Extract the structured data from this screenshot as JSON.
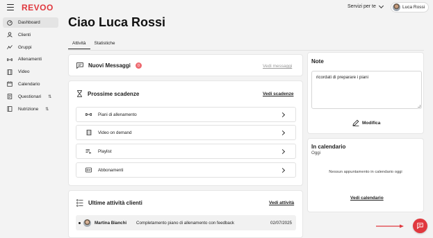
{
  "app": {
    "logo": "REVOO",
    "services_label": "Servizi per te",
    "user_name": "Luca Rossi"
  },
  "sidebar": {
    "items": [
      {
        "label": "Dashboard",
        "icon": "gauge-icon",
        "active": true
      },
      {
        "label": "Clienti",
        "icon": "user-icon"
      },
      {
        "label": "Gruppi",
        "icon": "group-icon"
      },
      {
        "label": "Allenamenti",
        "icon": "dumbbell-icon"
      },
      {
        "label": "Video",
        "icon": "film-icon"
      },
      {
        "label": "Calendario",
        "icon": "calendar-icon"
      },
      {
        "label": "Questionari",
        "icon": "document-icon",
        "extra": "sort-icon"
      },
      {
        "label": "Nutrizione",
        "icon": "book-icon",
        "extra": "sort-icon"
      }
    ]
  },
  "page": {
    "title": "Ciao Luca Rossi",
    "tabs": [
      "Attività",
      "Statistiche"
    ],
    "active_tab": "Attività"
  },
  "messages": {
    "title": "Nuovi Messaggi",
    "count": "0",
    "link": "Vedi messaggi"
  },
  "deadlines": {
    "title": "Prossime scadenze",
    "link": "Vedi scadenze",
    "rows": [
      {
        "label": "Piani di allenamento",
        "icon": "dumbbell-icon"
      },
      {
        "label": "Video on demand",
        "icon": "film-icon"
      },
      {
        "label": "Playlist",
        "icon": "playlist-icon"
      },
      {
        "label": "Abbonamenti",
        "icon": "card-icon"
      }
    ]
  },
  "activity": {
    "title": "Ultime attività clienti",
    "link": "Vedi attività",
    "rows": [
      {
        "name": "Martina Bianchi",
        "description": "Completamento piano di allenamento con feedback",
        "date": "02/07/2025"
      }
    ]
  },
  "note": {
    "title": "Note",
    "text": "ricordati di preparare i piani",
    "edit_label": "Modifica"
  },
  "calendar": {
    "title": "In calendario",
    "subtitle": "Oggi",
    "empty": "Nessun appuntamento in calendario oggi",
    "link": "Vedi calendario"
  },
  "colors": {
    "brand": "#e0383e",
    "badge": "#ee6a70"
  }
}
